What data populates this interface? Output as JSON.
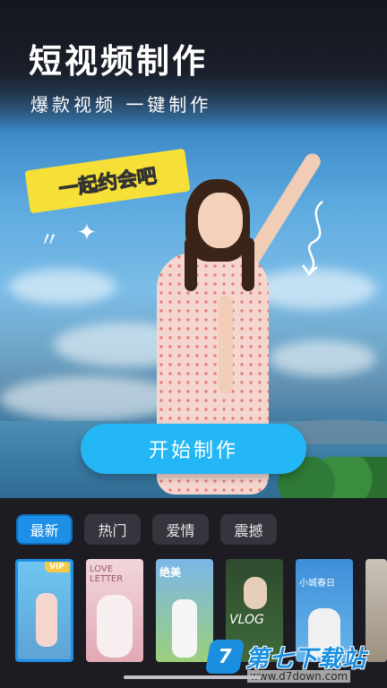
{
  "hero": {
    "title": "短视频制作",
    "subtitle": "爆款视频 一键制作",
    "sticker_text": "一起约会吧",
    "cta_label": "开始制作"
  },
  "tabs": [
    {
      "label": "最新",
      "active": true
    },
    {
      "label": "热门",
      "active": false
    },
    {
      "label": "爱情",
      "active": false
    },
    {
      "label": "震撼",
      "active": false
    }
  ],
  "thumbnails": [
    {
      "label": "",
      "badge": "VIP",
      "selected": true,
      "color_top": "#6ec6f0",
      "color_bottom": "#5ea3d4"
    },
    {
      "label": "LOVE LETTER",
      "badge": "",
      "selected": false,
      "color_top": "#f1d6dc",
      "color_bottom": "#e2a9b4"
    },
    {
      "label": "绝美",
      "badge": "",
      "selected": false,
      "color_top": "#7bb7e8",
      "color_bottom": "#9ccf7c"
    },
    {
      "label": "VLOG",
      "badge": "",
      "selected": false,
      "color_top": "#2f4b2e",
      "color_bottom": "#3f6a3a"
    },
    {
      "label": "小城春日",
      "badge": "",
      "selected": false,
      "color_top": "#3d8fd9",
      "color_bottom": "#6bb5ea"
    },
    {
      "label": "",
      "badge": "",
      "selected": false,
      "color_top": "#c9c3b8",
      "color_bottom": "#9c8f7f"
    }
  ],
  "watermark": {
    "logo": "7",
    "text": "第七下载站",
    "url": "www.d7down.com"
  },
  "colors": {
    "accent": "#1d8fe6",
    "cta": "#24b7f5",
    "background": "#1c1c22"
  }
}
